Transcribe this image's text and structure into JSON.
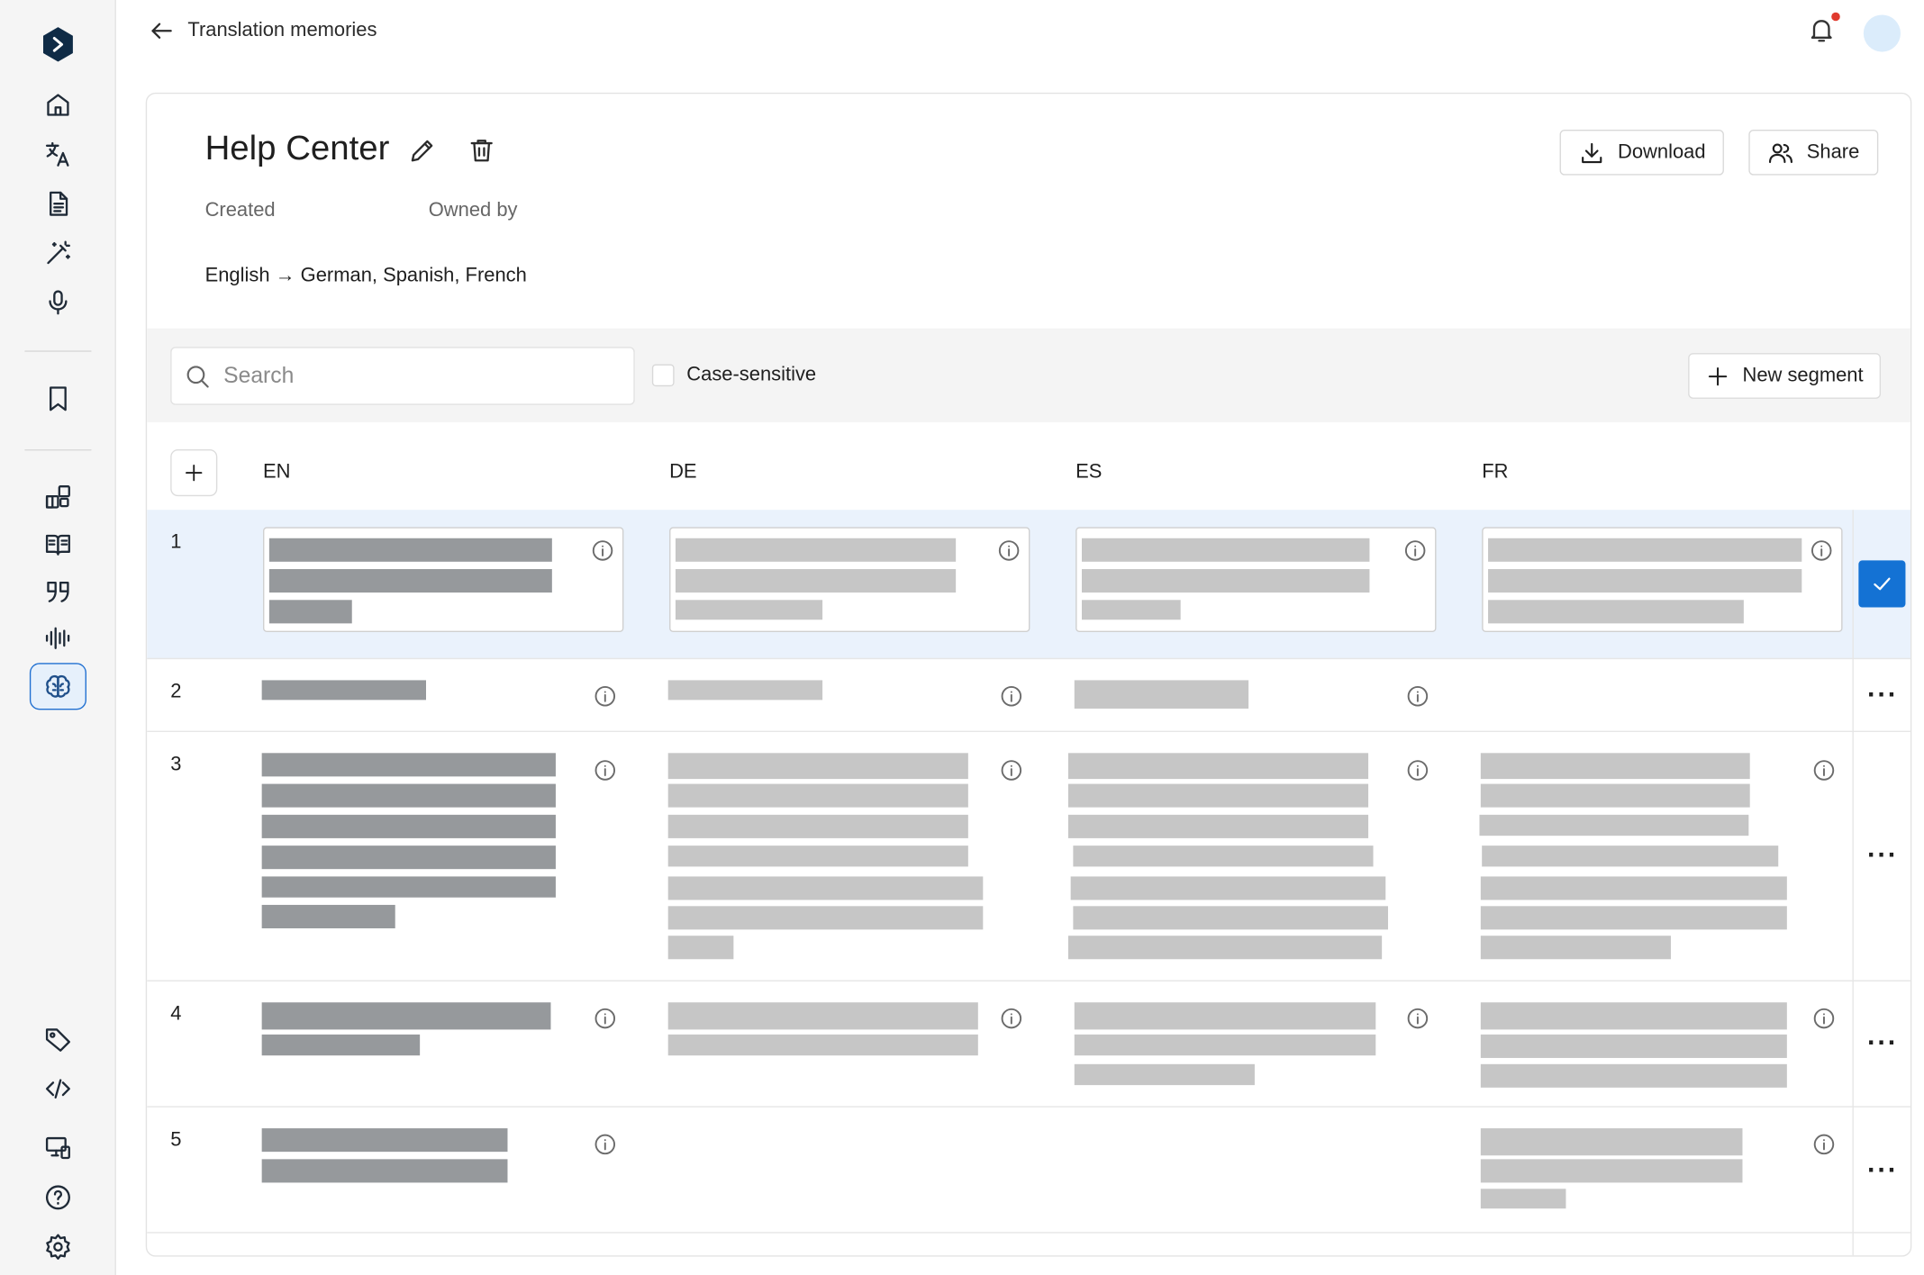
{
  "header": {
    "back_label": "Translation memories"
  },
  "memory": {
    "name": "Help Center",
    "created_label": "Created",
    "owned_by_label": "Owned by",
    "language_pair": "English → German, Spanish, French"
  },
  "actions": {
    "download_label": "Download",
    "share_label": "Share",
    "new_segment_label": "New segment"
  },
  "filters": {
    "search_placeholder": "Search",
    "case_sensitive_label": "Case-sensitive",
    "case_sensitive_checked": false
  },
  "columns": [
    "EN",
    "DE",
    "ES",
    "FR"
  ],
  "rows": [
    {
      "number": "1",
      "selected": true
    },
    {
      "number": "2",
      "selected": false
    },
    {
      "number": "3",
      "selected": false
    },
    {
      "number": "4",
      "selected": false
    },
    {
      "number": "5",
      "selected": false
    }
  ],
  "icons": {
    "sidebar_top": [
      "home-icon",
      "translate-icon",
      "document-icon",
      "magic-wand-icon",
      "microphone-icon"
    ],
    "sidebar_mid": [
      "bookmark-icon"
    ],
    "sidebar_tools": [
      "integrations-icon",
      "glossary-icon",
      "quote-icon",
      "waveform-icon",
      "brain-icon"
    ],
    "sidebar_bottom": [
      "tag-icon",
      "code-icon",
      "devices-icon",
      "help-icon",
      "settings-icon"
    ]
  },
  "colors": {
    "accent": "#1472d4",
    "selected_row": "#eaf2fc",
    "notification": "#e03a2e"
  }
}
